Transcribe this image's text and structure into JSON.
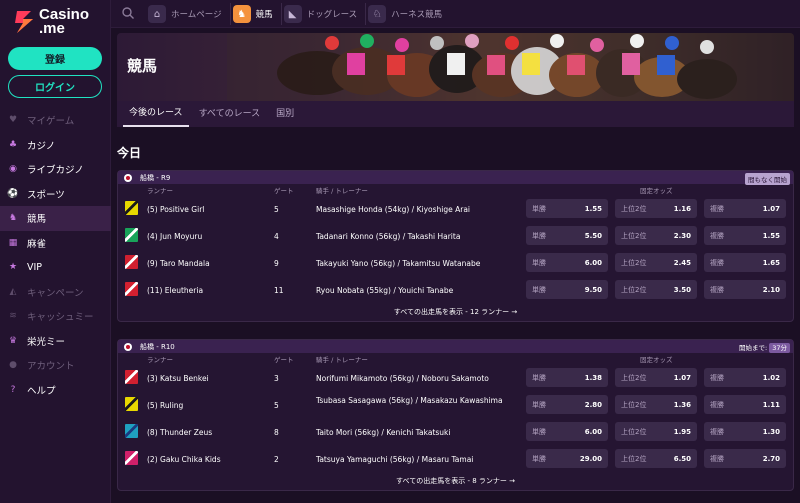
{
  "brand": {
    "name_line1": "Casino",
    "name_line2": ".me"
  },
  "sidebar": {
    "register_label": "登録",
    "login_label": "ログイン",
    "items": [
      {
        "label": "マイゲーム",
        "icon": "heart-icon",
        "dim": true
      },
      {
        "label": "カジノ",
        "icon": "cards-icon",
        "dim": false
      },
      {
        "label": "ライブカジノ",
        "icon": "chip-icon",
        "dim": false
      },
      {
        "label": "スポーツ",
        "icon": "ball-icon",
        "dim": false
      },
      {
        "label": "競馬",
        "icon": "horse-icon",
        "dim": false,
        "active": true
      },
      {
        "label": "麻雀",
        "icon": "mahjong-icon",
        "dim": false
      },
      {
        "label": "VIP",
        "icon": "star-icon",
        "dim": false
      },
      {
        "label": "キャンペーン",
        "icon": "megaphone-icon",
        "dim": true
      },
      {
        "label": "キャッシュミー",
        "icon": "cash-icon",
        "dim": true
      },
      {
        "label": "栄光ミー",
        "icon": "trophy-icon",
        "dim": false
      },
      {
        "label": "アカウント",
        "icon": "user-icon",
        "dim": true
      },
      {
        "label": "ヘルプ",
        "icon": "help-icon",
        "dim": false
      }
    ]
  },
  "topnav": [
    {
      "label": "ホームページ",
      "icon": "home-icon"
    },
    {
      "label": "競馬",
      "icon": "horse-racing-icon",
      "active": true
    },
    {
      "label": "ドッグレース",
      "icon": "dog-icon"
    },
    {
      "label": "ハーネス競馬",
      "icon": "harness-icon"
    }
  ],
  "page": {
    "title": "競馬",
    "tabs": [
      "今後のレース",
      "すべてのレース",
      "国別"
    ],
    "section_title": "今日"
  },
  "columns": {
    "runner": "ランナー",
    "gate": "ゲート",
    "jockey": "騎手 / トレーナー",
    "fixed_odds": "固定オッズ"
  },
  "races": [
    {
      "name": "船橋 - R9",
      "status": "間もなく開始",
      "footer": "すべての出走馬を表示 - 12 ランナー →",
      "runners": [
        {
          "horse": "(5) Positive Girl",
          "gate": "5",
          "jockey": "Masashige Honda (54kg) / Kiyoshige Arai",
          "win_label": "単勝",
          "win": "1.55",
          "place2_label": "上位2位",
          "place2": "1.16",
          "show_label": "複勝",
          "show": "1.07",
          "silk": "#e8d800",
          "silk2": "#1a1a1a"
        },
        {
          "horse": "(4) Jun Moyuru",
          "gate": "4",
          "jockey": "Tadanari Konno (56kg) / Takashi Harita",
          "win_label": "単勝",
          "win": "5.50",
          "place2_label": "上位2位",
          "place2": "2.30",
          "show_label": "複勝",
          "show": "1.55",
          "silk": "#19a35a",
          "silk2": "#ffffff"
        },
        {
          "horse": "(9) Taro Mandala",
          "gate": "9",
          "jockey": "Takayuki Yano (56kg) / Takamitsu Watanabe",
          "win_label": "単勝",
          "win": "6.00",
          "place2_label": "上位2位",
          "place2": "2.45",
          "show_label": "複勝",
          "show": "1.65",
          "silk": "#d02030",
          "silk2": "#ffffff"
        },
        {
          "horse": "(11) Eleutheria",
          "gate": "11",
          "jockey": "Ryou Nobata (55kg) / Youichi Tanabe",
          "win_label": "単勝",
          "win": "9.50",
          "place2_label": "上位2位",
          "place2": "3.50",
          "show_label": "複勝",
          "show": "2.10",
          "silk": "#d42030",
          "silk2": "#ffffff"
        }
      ]
    },
    {
      "name": "船橋 - R10",
      "status_prefix": "開始まで:",
      "status": "37分",
      "footer": "すべての出走馬を表示 - 8 ランナー →",
      "runners": [
        {
          "horse": "(3) Katsu Benkei",
          "gate": "3",
          "jockey": "Norifumi Mikamoto (56kg) / Noboru Sakamoto",
          "win_label": "単勝",
          "win": "1.38",
          "place2_label": "上位2位",
          "place2": "1.07",
          "show_label": "複勝",
          "show": "1.02",
          "silk": "#d02030",
          "silk2": "#ffffff"
        },
        {
          "horse": "(5) Ruling",
          "gate": "5",
          "jockey": "Tsubasa Sasagawa (56kg) / Masakazu Kawashima",
          "win_label": "単勝",
          "win": "2.80",
          "place2_label": "上位2位",
          "place2": "1.36",
          "show_label": "複勝",
          "show": "1.11",
          "silk": "#e8d800",
          "silk2": "#1a1a1a"
        },
        {
          "horse": "(8) Thunder Zeus",
          "gate": "8",
          "jockey": "Taito Mori (56kg) / Kenichi Takatsuki",
          "win_label": "単勝",
          "win": "6.00",
          "place2_label": "上位2位",
          "place2": "1.95",
          "show_label": "複勝",
          "show": "1.30",
          "silk": "#1fa0c0",
          "silk2": "#1a3a80"
        },
        {
          "horse": "(2) Gaku Chika Kids",
          "gate": "2",
          "jockey": "Tatsuya Yamaguchi (56kg) / Masaru Tamai",
          "win_label": "単勝",
          "win": "29.00",
          "place2_label": "上位2位",
          "place2": "6.50",
          "show_label": "複勝",
          "show": "2.70",
          "silk": "#d0206a",
          "silk2": "#ffffff"
        }
      ]
    }
  ]
}
